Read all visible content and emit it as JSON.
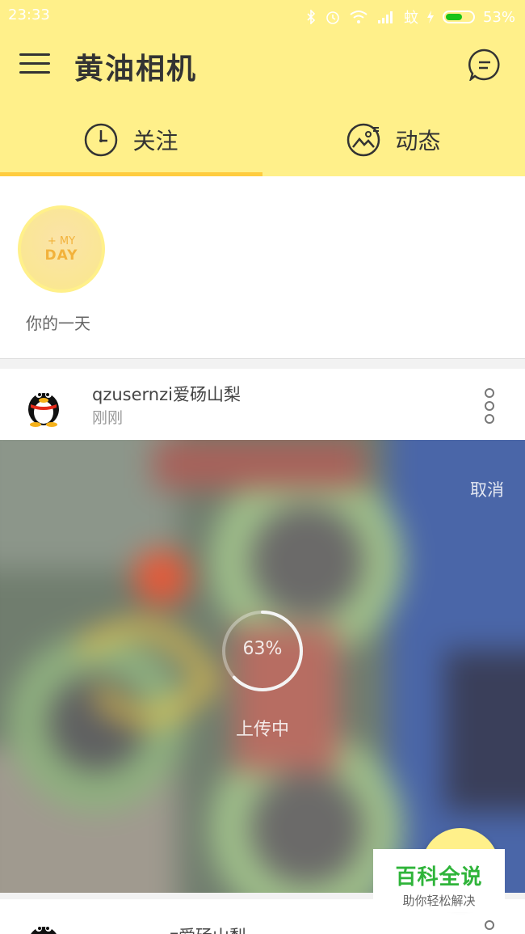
{
  "status_bar": {
    "time": "23:33",
    "carrier": "蚊",
    "battery": "53%"
  },
  "app": {
    "title": "黄油相机"
  },
  "tabs": [
    {
      "label": "关注",
      "active": true
    },
    {
      "label": "动态",
      "active": false
    }
  ],
  "my_day": {
    "badge_line1": "+ MY",
    "badge_line2": "DAY",
    "label": "你的一天"
  },
  "post": {
    "user": "qzusernzi爱砀山梨",
    "time": "刚刚",
    "cancel_label": "取消",
    "progress_text": "63%",
    "progress_value": 0.63,
    "uploading_label": "上传中"
  },
  "post2": {
    "user": "z爱砀山梨"
  },
  "watermark": {
    "title": "百科全说",
    "subtitle": "助你轻松解决"
  },
  "colors": {
    "header_bg": "#fff08a",
    "tab_indicator": "#ffcc3f",
    "watermark_green": "#2fb43a"
  },
  "icons": [
    "menu-icon",
    "chat-bubble-icon",
    "clock-icon",
    "picture-icon",
    "more-vertical-icon",
    "qq-penguin-icon"
  ]
}
